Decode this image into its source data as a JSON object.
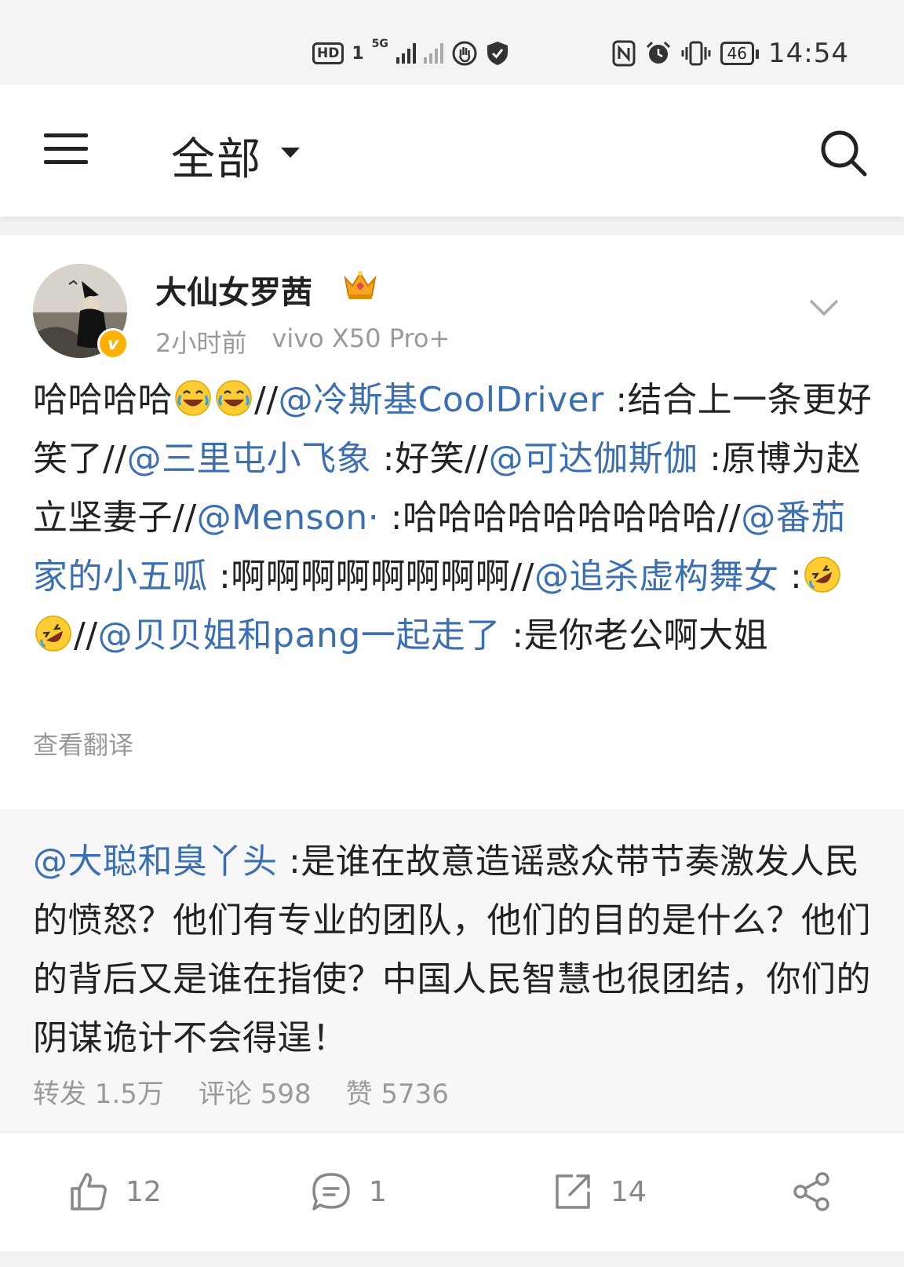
{
  "status_bar": {
    "hd_label": "HD",
    "sim_label": "1",
    "network_label": "5G",
    "battery_level": "46",
    "time": "14:54"
  },
  "header": {
    "title": "全部",
    "icons": [
      "menu-icon",
      "search-icon"
    ]
  },
  "post": {
    "author": "大仙女罗茜",
    "verified_badge": "v",
    "time_ago": "2小时前",
    "device": "vivo X50 Pro+",
    "segments": [
      {
        "type": "text",
        "text": "哈哈哈哈"
      },
      {
        "type": "emoji",
        "name": "laugh-cry-emoji"
      },
      {
        "type": "emoji",
        "name": "laugh-cry-emoji"
      },
      {
        "type": "text",
        "text": "//"
      },
      {
        "type": "mention",
        "text": "@冷斯基CoolDriver"
      },
      {
        "type": "text",
        "text": " :结合上一条更好笑了//"
      },
      {
        "type": "mention",
        "text": "@三里屯小飞象"
      },
      {
        "type": "text",
        "text": " :好笑//"
      },
      {
        "type": "mention",
        "text": "@可达伽斯伽"
      },
      {
        "type": "text",
        "text": " :原博为赵立坚妻子//"
      },
      {
        "type": "mention",
        "text": "@Menson·"
      },
      {
        "type": "text",
        "text": " :哈哈哈哈哈哈哈哈哈//"
      },
      {
        "type": "mention",
        "text": "@番茄家的小五呱"
      },
      {
        "type": "text",
        "text": " :啊啊啊啊啊啊啊啊//"
      },
      {
        "type": "mention",
        "text": "@追杀虚构舞女"
      },
      {
        "type": "text",
        "text": " :"
      },
      {
        "type": "emoji",
        "name": "rofl-emoji"
      },
      {
        "type": "emoji",
        "name": "rofl-emoji"
      },
      {
        "type": "text",
        "text": "//"
      },
      {
        "type": "mention",
        "text": "@贝贝姐和pang一起走了"
      },
      {
        "type": "text",
        "text": " :是你老公啊大姐"
      }
    ],
    "translate_label": "查看翻译"
  },
  "repost": {
    "mention": "@大聪和臭丫头",
    "text": " :是谁在故意造谣惑众带节奏激发人民的愤怒？他们有专业的团队，他们的目的是什么？他们的背后又是谁在指使？中国人民智慧也很团结，你们的阴谋诡计不会得逞！",
    "stats": {
      "repost": "转发 1.5万",
      "comment": "评论 598",
      "like": "赞 5736"
    }
  },
  "actions": {
    "like_count": "12",
    "comment_count": "1",
    "repost_count": "14"
  },
  "colors": {
    "mention": "#3b6fb3",
    "meta_gray": "#9a9a9a",
    "badge_orange": "#ffb000"
  }
}
